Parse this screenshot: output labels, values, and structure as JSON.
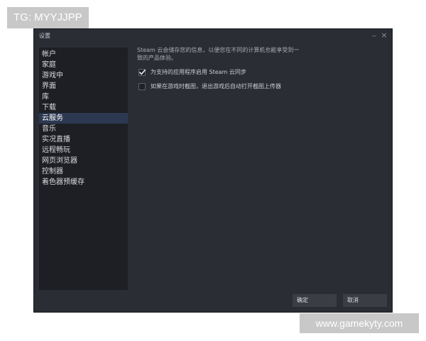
{
  "watermarks": {
    "top": "TG: MYYJJPP",
    "bottom": "www.gamekyty.com"
  },
  "window": {
    "title": "设置",
    "minimize_glyph": "_",
    "close_glyph": "×"
  },
  "sidebar": {
    "items": [
      {
        "label": "帐户"
      },
      {
        "label": "家庭"
      },
      {
        "label": "游戏中"
      },
      {
        "label": "界面"
      },
      {
        "label": "库"
      },
      {
        "label": "下载"
      },
      {
        "label": "云服务",
        "selected": true
      },
      {
        "label": "音乐"
      },
      {
        "label": "实况直播"
      },
      {
        "label": "远程畅玩"
      },
      {
        "label": "网页浏览器"
      },
      {
        "label": "控制器"
      },
      {
        "label": "着色器预缓存"
      }
    ]
  },
  "cloud": {
    "description_line1": "Steam 云会储存您的信息，以便您在不同的计算机也能享受到一",
    "description_line2": "致的产品体验。",
    "options": [
      {
        "label": "为支持的应用程序启用 Steam 云同步",
        "checked": true
      },
      {
        "label": "如果在游戏时截图，退出游戏后自动打开截图上传器",
        "checked": false
      }
    ]
  },
  "buttons": {
    "ok": "确定",
    "cancel": "取消"
  },
  "icons": {
    "check": "check-icon",
    "close": "close-icon",
    "minimize": "minimize-icon"
  }
}
